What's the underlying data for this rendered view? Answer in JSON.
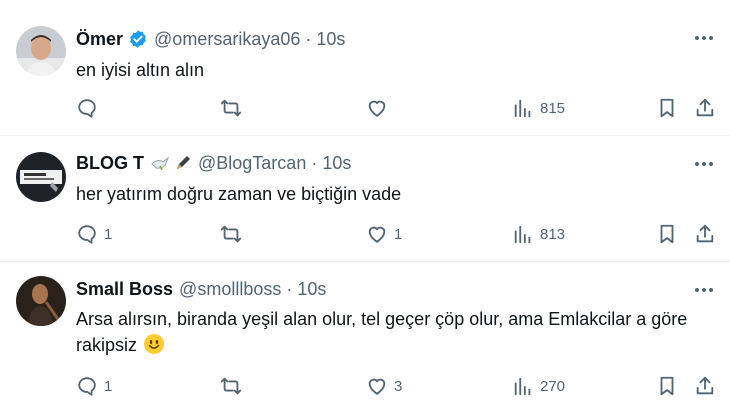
{
  "tweets": [
    {
      "name": "Ömer",
      "handle": "@omersarikaya06",
      "separator": "·",
      "time": "10s",
      "verified": true,
      "text": "en iyisi altın alın",
      "stats": {
        "replies": "",
        "retweets": "",
        "likes": "",
        "views": "815"
      }
    },
    {
      "name": "BLOG T",
      "handle": "@BlogTarcan",
      "separator": "·",
      "time": "10s",
      "badges": [
        "dove-emoji",
        "pen-emoji"
      ],
      "text": "her yatırım doğru zaman ve biçtiğin vade",
      "stats": {
        "replies": "1",
        "retweets": "",
        "likes": "1",
        "views": "813"
      }
    },
    {
      "name": "Small Boss",
      "handle": "@smolllboss",
      "separator": "·",
      "time": "10s",
      "text": "Arsa  alırsın, biranda yeşil alan olur, tel geçer çöp olur, ama Emlakcilar a göre rakipsiz",
      "emoji": "smiling-face-emoji",
      "stats": {
        "replies": "1",
        "retweets": "",
        "likes": "3",
        "views": "270"
      }
    }
  ],
  "colors": {
    "text": "#0f1419",
    "secondary": "#536471",
    "verified": "#1d9bf0",
    "divider": "#eff3f4"
  }
}
